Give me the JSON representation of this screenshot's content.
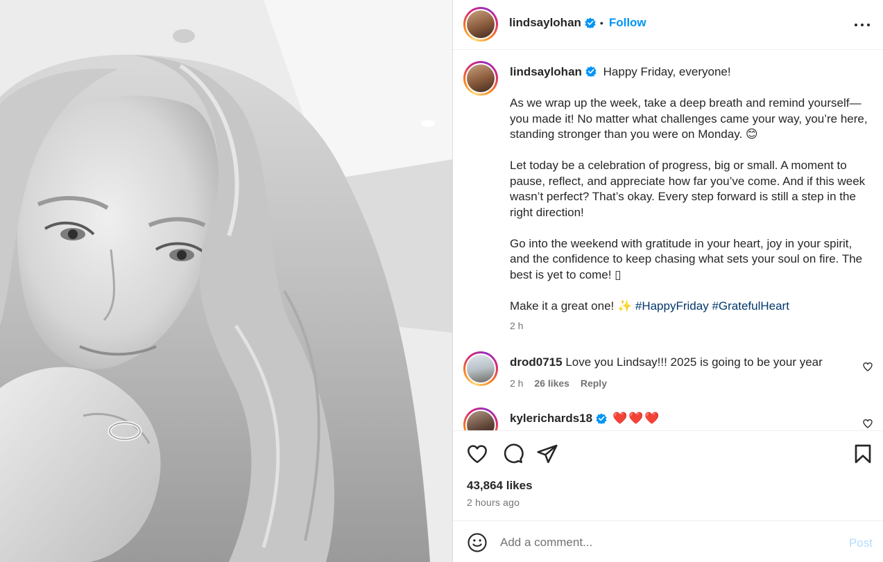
{
  "post_image": {
    "icon": "post-photo",
    "description_visible": false
  },
  "header": {
    "username": "lindsaylohan",
    "verified": true,
    "separator": "•",
    "follow_label": "Follow",
    "more_icon": "more-horizontal-icon"
  },
  "caption": {
    "username": "lindsaylohan",
    "verified": true,
    "paragraphs": [
      "Happy Friday, everyone!",
      "As we wrap up the week, take a deep breath and remind yourself—you made it! No matter what challenges came your way, you’re here, standing stronger than you were on Monday. 😊",
      "Let today be a celebration of progress, big or small. A moment to pause, reflect, and appreciate how far you’ve come. And if this week wasn’t perfect? That’s okay. Every step forward is still a step in the right direction!",
      "Go into the weekend with gratitude in your heart, joy in your spirit, and the confidence to keep chasing what sets your soul on fire. The best is yet to come! ▯"
    ],
    "last_line_text": "Make it a great one! ✨ ",
    "hashtags": [
      "#HappyFriday",
      "#GratefulHeart"
    ],
    "time": "2 h"
  },
  "comments": [
    {
      "username": "drod0715",
      "verified": false,
      "text": "Love you Lindsay!!! 2025 is going to be your year",
      "time": "2 h",
      "likes": "26 likes",
      "reply_label": "Reply"
    },
    {
      "username": "kylerichards18",
      "verified": true,
      "text": "❤️❤️❤️"
    }
  ],
  "actions": {
    "like_icon": "heart-outline-icon",
    "comment_icon": "comment-icon",
    "share_icon": "send-icon",
    "save_icon": "bookmark-icon"
  },
  "likes_text": "43,864 likes",
  "posted_ago": "2 hours ago",
  "comment_box": {
    "emoji_icon": "smiley-icon",
    "placeholder": "Add a comment...",
    "post_label": "Post"
  },
  "colors": {
    "accent_blue": "#0095f6",
    "hashtag_blue": "#00376b",
    "muted_text": "#737373",
    "post_disabled": "#b3dbff",
    "heart_red": "#ed1c24"
  }
}
